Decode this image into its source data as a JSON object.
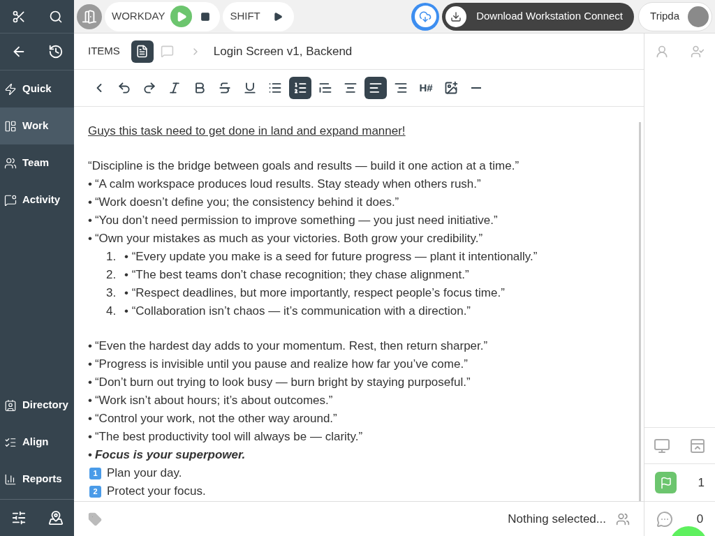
{
  "topbar": {
    "workday": {
      "label": "WORKDAY",
      "running": true
    },
    "shift": {
      "label": "SHIFT"
    },
    "download": {
      "label": "Download Workstation Connect"
    },
    "user": {
      "name": "Tripda"
    }
  },
  "sidebar": {
    "items": [
      {
        "label": "Quick",
        "selected": false
      },
      {
        "label": "Work",
        "selected": true
      },
      {
        "label": "Team",
        "selected": false
      },
      {
        "label": "Activity",
        "selected": false
      },
      {
        "label": "Directory",
        "selected": false
      },
      {
        "label": "Align",
        "selected": false
      },
      {
        "label": "Reports",
        "selected": false
      }
    ]
  },
  "breadcrumb": {
    "section": "ITEMS",
    "views": [
      {
        "kind": "document",
        "selected": true
      },
      {
        "kind": "comments",
        "selected": false
      }
    ],
    "title": "Login Screen v1, Backend"
  },
  "toolbar": [
    {
      "kind": "back",
      "selected": false
    },
    {
      "kind": "undo",
      "selected": false
    },
    {
      "kind": "redo",
      "selected": false
    },
    {
      "kind": "italic",
      "selected": false
    },
    {
      "kind": "bold",
      "selected": false
    },
    {
      "kind": "strike",
      "selected": false
    },
    {
      "kind": "underline",
      "selected": false
    },
    {
      "kind": "bullet-list",
      "selected": false
    },
    {
      "kind": "numbered-list",
      "selected": true
    },
    {
      "kind": "quote",
      "selected": false
    },
    {
      "kind": "align-center",
      "selected": false
    },
    {
      "kind": "align-left",
      "selected": true
    },
    {
      "kind": "align-right",
      "selected": false
    },
    {
      "kind": "heading",
      "label": "H#",
      "selected": false
    },
    {
      "kind": "image",
      "selected": false
    },
    {
      "kind": "rule",
      "selected": false
    }
  ],
  "content": [
    {
      "kind": "underline",
      "text": "Guys this task need to get done in land and expand manner!"
    },
    {
      "kind": "gap"
    },
    {
      "kind": "plain",
      "text": "“Discipline is the bridge between goals and results — build it one action at a time.”"
    },
    {
      "kind": "bullet",
      "marker": "•",
      "text": "“A calm workspace produces loud results. Stay steady when others rush.”",
      "emphasis": false
    },
    {
      "kind": "bullet",
      "marker": "•",
      "text": "“Work doesn’t define you; the consistency behind it does.”",
      "emphasis": false
    },
    {
      "kind": "bullet",
      "marker": "•",
      "text": "“You don’t need permission to improve something — you just need initiative.”",
      "emphasis": false
    },
    {
      "kind": "bullet",
      "marker": "•",
      "text": "“Own your mistakes as much as your victories. Both grow your credibility.”",
      "emphasis": false
    },
    {
      "kind": "numbered",
      "marker": "1.",
      "text": "• “Every update you make is a seed for future progress — plant it intentionally.”"
    },
    {
      "kind": "numbered",
      "marker": "2.",
      "text": "• “The best teams don’t chase recognition; they chase alignment.”"
    },
    {
      "kind": "numbered",
      "marker": "3.",
      "text": "• “Respect deadlines, but more importantly, respect people’s focus time.”"
    },
    {
      "kind": "numbered",
      "marker": "4.",
      "text": "• “Collaboration isn’t chaos — it’s communication with a direction.”"
    },
    {
      "kind": "gap"
    },
    {
      "kind": "bullet",
      "marker": "•",
      "text": "“Even the hardest day adds to your momentum. Rest, then return sharper.”",
      "emphasis": false
    },
    {
      "kind": "bullet",
      "marker": "•",
      "text": "“Progress is invisible until you pause and realize how far you’ve come.”",
      "emphasis": false
    },
    {
      "kind": "bullet",
      "marker": "•",
      "text": "“Don’t burn out trying to look busy — burn bright by staying purposeful.”",
      "emphasis": false
    },
    {
      "kind": "bullet",
      "marker": "•",
      "text": "“Work isn’t about hours; it’s about outcomes.”",
      "emphasis": false
    },
    {
      "kind": "bullet",
      "marker": "•",
      "text": "“Control your work, not the other way around.”",
      "emphasis": false
    },
    {
      "kind": "bullet",
      "marker": "•",
      "text": "“The best productivity tool will always be — clarity.”",
      "emphasis": false
    },
    {
      "kind": "bullet",
      "marker": "•",
      "text": "Focus is your superpower.",
      "emphasis": true
    },
    {
      "kind": "keycap",
      "marker": "1",
      "text": "Plan your day."
    },
    {
      "kind": "keycap",
      "marker": "2",
      "text": "Protect your focus."
    }
  ],
  "footer": {
    "status": "Nothing selected..."
  },
  "side_panel": {
    "flags": "1",
    "comments": "0"
  }
}
